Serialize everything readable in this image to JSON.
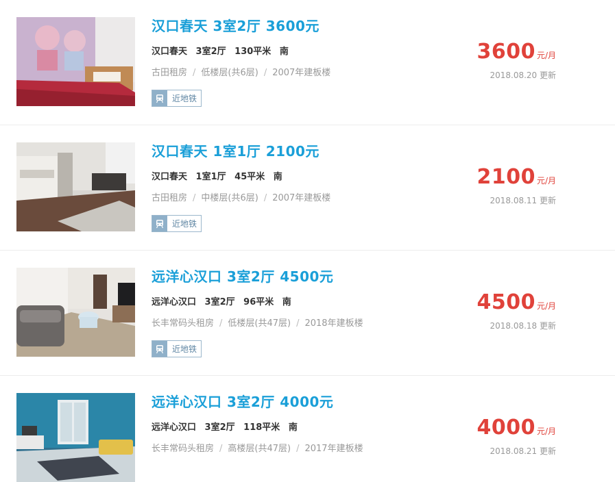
{
  "listings": [
    {
      "title": "汉口春天 3室2厅 3600元",
      "community": "汉口春天",
      "layout": "3室2厅",
      "area": "130平米",
      "orientation": "南",
      "district": "古田租房",
      "floor": "低楼层(共6层)",
      "building": "2007年建板楼",
      "tag": "近地铁",
      "price": "3600",
      "price_unit": "元/月",
      "updated": "2018.08.20 更新",
      "photo_icon": "bedroom-photo"
    },
    {
      "title": "汉口春天 1室1厅 2100元",
      "community": "汉口春天",
      "layout": "1室1厅",
      "area": "45平米",
      "orientation": "南",
      "district": "古田租房",
      "floor": "中楼层(共6层)",
      "building": "2007年建板楼",
      "tag": "近地铁",
      "price": "2100",
      "price_unit": "元/月",
      "updated": "2018.08.11 更新",
      "photo_icon": "living-room-photo"
    },
    {
      "title": "远洋心汉口 3室2厅 4500元",
      "community": "远洋心汉口",
      "layout": "3室2厅",
      "area": "96平米",
      "orientation": "南",
      "district": "长丰常码头租房",
      "floor": "低楼层(共47层)",
      "building": "2018年建板楼",
      "tag": "近地铁",
      "price": "4500",
      "price_unit": "元/月",
      "updated": "2018.08.18 更新",
      "photo_icon": "sofa-room-photo"
    },
    {
      "title": "远洋心汉口 3室2厅 4000元",
      "community": "远洋心汉口",
      "layout": "3室2厅",
      "area": "118平米",
      "orientation": "南",
      "district": "长丰常码头租房",
      "floor": "高楼层(共47层)",
      "building": "2017年建板楼",
      "price": "4000",
      "price_unit": "元/月",
      "updated": "2018.08.21 更新",
      "photo_icon": "blue-wall-room-photo"
    }
  ],
  "colors": {
    "title": "#1a9fd8",
    "price": "#e0423a",
    "meta": "#999999",
    "tag_border": "#9bb7cc"
  }
}
